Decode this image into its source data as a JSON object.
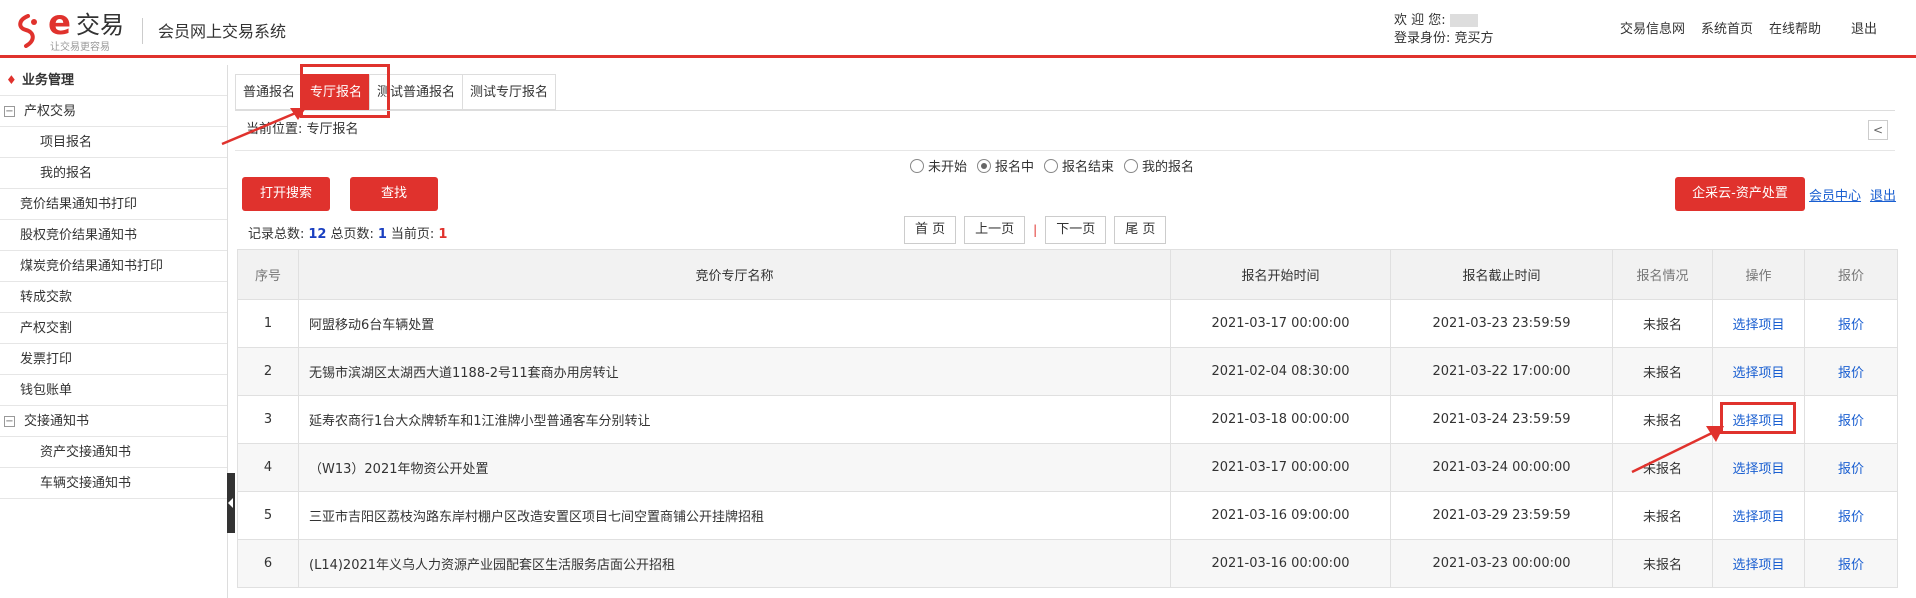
{
  "header": {
    "logo_letter": "e",
    "logo_name": "交易",
    "logo_slogan": "让交易更容易",
    "system_title": "会员网上交易系统",
    "welcome_label": "欢 迎 您:",
    "identity_label": "登录身份:",
    "identity_value": "竞买方",
    "links": [
      "交易信息网",
      "系统首页",
      "在线帮助"
    ],
    "logout": "退出"
  },
  "sidebar": {
    "head": "业务管理",
    "items": [
      {
        "label": "产权交易",
        "type": "group"
      },
      {
        "label": "项目报名",
        "type": "sub"
      },
      {
        "label": "我的报名",
        "type": "sub"
      },
      {
        "label": "竞价结果通知书打印",
        "type": "item"
      },
      {
        "label": "股权竞价结果通知书",
        "type": "item"
      },
      {
        "label": "煤炭竞价结果通知书打印",
        "type": "item"
      },
      {
        "label": "转成交款",
        "type": "item"
      },
      {
        "label": "产权交割",
        "type": "item"
      },
      {
        "label": "发票打印",
        "type": "item"
      },
      {
        "label": "钱包账单",
        "type": "item"
      },
      {
        "label": "交接通知书",
        "type": "group"
      },
      {
        "label": "资产交接通知书",
        "type": "sub"
      },
      {
        "label": "车辆交接通知书",
        "type": "sub"
      }
    ],
    "toggle_minus": "−"
  },
  "tabs": [
    "普通报名",
    "专厅报名",
    "测试普通报名",
    "测试专厅报名"
  ],
  "breadcrumb": "当前位置: 专厅报名",
  "collapse_glyph": "<",
  "filters": {
    "options": [
      "未开始",
      "报名中",
      "报名结束",
      "我的报名"
    ],
    "selected_index": 1
  },
  "buttons": {
    "open_search": "打开搜索",
    "find": "查找",
    "qcy": "企采云-资产处置",
    "member_center": "会员中心",
    "exit": "退出"
  },
  "records": {
    "total_label": "记录总数:",
    "total": "12",
    "pages_label": "总页数:",
    "pages": "1",
    "current_label": "当前页:",
    "current": "1"
  },
  "pager": {
    "first": "首 页",
    "prev": "上一页",
    "sep": "|",
    "next": "下一页",
    "last": "尾 页"
  },
  "table": {
    "headers": [
      "序号",
      "竞价专厅名称",
      "报名开始时间",
      "报名截止时间",
      "报名情况",
      "操作",
      "报价"
    ],
    "rows": [
      {
        "no": "1",
        "name": "阿盟移动6台车辆处置",
        "start": "2021-03-17 00:00:00",
        "end": "2021-03-23 23:59:59",
        "status": "未报名",
        "op": "选择项目",
        "bid": "报价"
      },
      {
        "no": "2",
        "name": "无锡市滨湖区太湖西大道1188-2号11套商办用房转让",
        "start": "2021-02-04 08:30:00",
        "end": "2021-03-22 17:00:00",
        "status": "未报名",
        "op": "选择项目",
        "bid": "报价"
      },
      {
        "no": "3",
        "name": "延寿农商行1台大众牌轿车和1江淮牌小型普通客车分别转让",
        "start": "2021-03-18 00:00:00",
        "end": "2021-03-24 23:59:59",
        "status": "未报名",
        "op": "选择项目",
        "bid": "报价"
      },
      {
        "no": "4",
        "name": "（W13）2021年物资公开处置",
        "start": "2021-03-17 00:00:00",
        "end": "2021-03-24 00:00:00",
        "status": "未报名",
        "op": "选择项目",
        "bid": "报价"
      },
      {
        "no": "5",
        "name": "三亚市吉阳区荔枝沟路东岸村棚户区改造安置区项目七间空置商铺公开挂牌招租",
        "start": "2021-03-16 09:00:00",
        "end": "2021-03-29 23:59:59",
        "status": "未报名",
        "op": "选择项目",
        "bid": "报价"
      },
      {
        "no": "6",
        "name": "(L14)2021年义乌人力资源产业园配套区生活服务店面公开招租",
        "start": "2021-03-16 00:00:00",
        "end": "2021-03-23 00:00:00",
        "status": "未报名",
        "op": "选择项目",
        "bid": "报价"
      }
    ]
  },
  "colors": {
    "accent": "#e0322d",
    "link": "#1a5fd1"
  }
}
